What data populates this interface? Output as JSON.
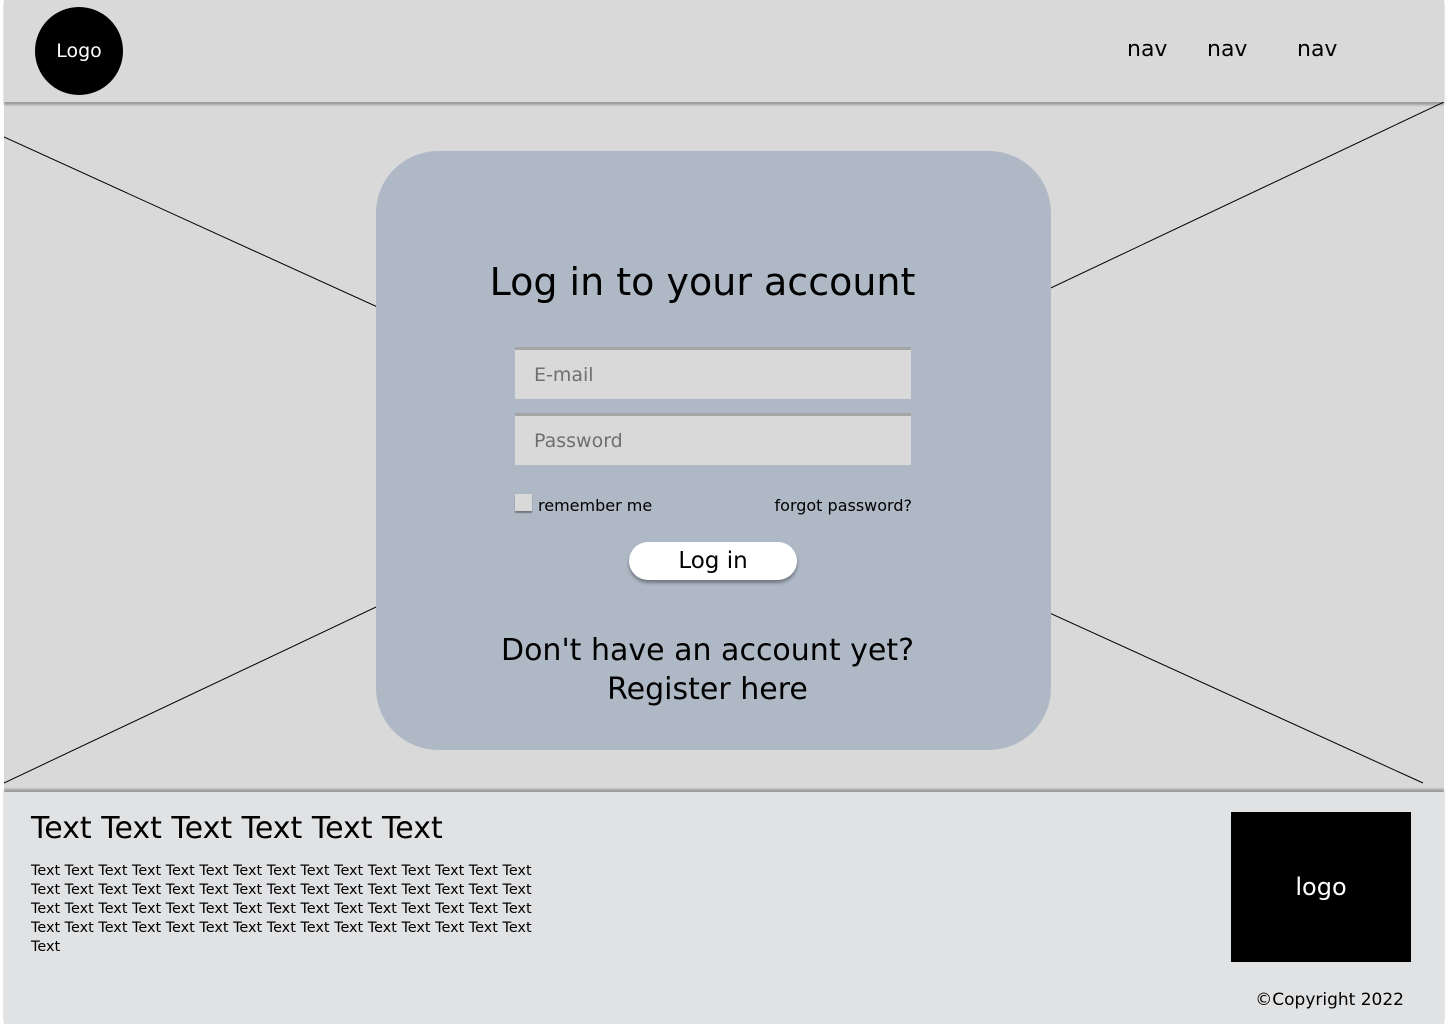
{
  "header": {
    "logo_label": "Logo",
    "nav": [
      "nav",
      "nav",
      "nav"
    ]
  },
  "login": {
    "title": "Log in to your account",
    "email_placeholder": "E-mail",
    "password_placeholder": "Password",
    "remember_label": "remember me",
    "forgot_label": "forgot password?",
    "submit_label": "Log in",
    "no_account_text": "Don't have an account yet?",
    "register_label": "Register here"
  },
  "footer": {
    "heading": "Text Text Text Text Text Text",
    "body": "Text Text Text Text Text Text Text Text Text Text Text Text Text Text Text Text Text Text Text Text Text Text Text Text Text Text Text Text Text Text Text Text Text Text Text Text Text Text Text Text Text Text Text Text Text Text Text Text Text Text Text Text Text Text Text Text Text Text Text Text Text",
    "logo_label": "logo",
    "copyright": "©Copyright 2022"
  },
  "colors": {
    "header_bg": "#d9d9d9",
    "card_bg": "#afb9c6",
    "footer_bg": "#e1e2e4",
    "logo_bg": "#000000"
  }
}
